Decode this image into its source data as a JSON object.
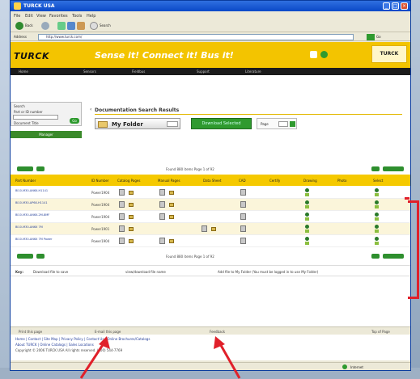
{
  "window": {
    "title": "TURCK USA"
  },
  "menu": [
    "File",
    "Edit",
    "View",
    "Favorites",
    "Tools",
    "Help"
  ],
  "toolbar": {
    "back_label": "Back",
    "search_label": "Search"
  },
  "address": {
    "label": "Address",
    "url": "http://www.turck.com/",
    "go_label": "Go"
  },
  "header": {
    "logo": "TURCK",
    "slogan": "Sense it! Connect it! Bus it!",
    "right_logo": "TURCK",
    "nav": [
      "Home",
      "Sensors",
      "Fieldbus",
      "Support",
      "Literature"
    ]
  },
  "leftnav": {
    "search_label": "Search",
    "part_label": "Part or ID number",
    "doc_label": "Document Title",
    "go_label": "Go",
    "green_label": "Manager"
  },
  "main": {
    "title": "Documentation Search Results",
    "folder_label": "My Folder",
    "download_label": "Download Selected",
    "pager_label": "Page",
    "found_top": "Found 880 items   Page 1 of 92",
    "found_bottom": "Found 880 items   Page 1 of 92",
    "columns": [
      "Part Number",
      "ID Number",
      "Catalog Pages",
      "Manual Pages",
      "Data Sheet",
      "CAD",
      "Certify",
      "Drawing",
      "Photo",
      "Select"
    ],
    "rows": [
      {
        "part": "BI10-M30-AN6X-H1141",
        "id": "Power1904"
      },
      {
        "part": "BI10-M30-AP6X-H1141",
        "id": "Power1904"
      },
      {
        "part": "BI10-M30-AN6X-2M-8MF",
        "id": "Power1904"
      },
      {
        "part": "BI10-M30-AN6X 7M",
        "id": "Power1901"
      },
      {
        "part": "BI10-M30-AN6X 7M Power",
        "id": "Power1904"
      }
    ]
  },
  "keybar": {
    "key_label": "Key:",
    "item1": "Download file to save",
    "item2": "view/download file name",
    "item3": "Add file to My Folder (You must be logged in to use My Folder)"
  },
  "footbar": {
    "print_label": "Print this page",
    "email_label": "E-mail this page",
    "feedback_label": "Feedback",
    "top_label": "Top of Page"
  },
  "footer": {
    "line1": "Home | Contact | Site Map | Privacy Policy | Contact Us | Online Brochures/Catalogs",
    "line2": "About TURCK | Online Catalogs | Sales Locations",
    "line3": "Copyright © 2006 TURCK USA All rights reserved. (800) 544-7769"
  },
  "status": {
    "zone": "Internet"
  },
  "colors": {
    "accent_yellow": "#f5c900",
    "turck_green": "#2f9a2f",
    "annotation_red": "#e0202a"
  }
}
